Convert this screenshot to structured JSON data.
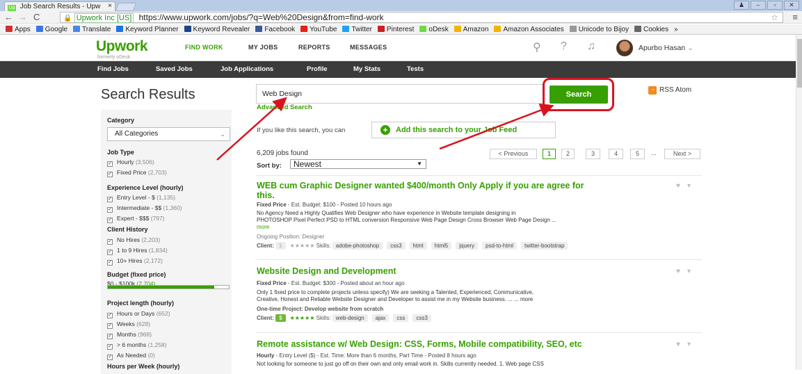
{
  "browser": {
    "tab_title": "Job Search Results - Upw",
    "tab_close": "×",
    "favicon": "Up",
    "url_org": "Upwork Inc [US]",
    "url": "https://www.upwork.com/jobs/?q=Web%20Design&from=find-work",
    "bookmarks": [
      {
        "label": "Apps",
        "icon_color": "#cc3333"
      },
      {
        "label": "Google",
        "icon_color": "#3b78e7"
      },
      {
        "label": "Translate",
        "icon_color": "#4a86e8"
      },
      {
        "label": "Keyword Planner",
        "icon_color": "#1a73e8"
      },
      {
        "label": "Keyword Revealer",
        "icon_color": "#1c4587"
      },
      {
        "label": "Facebook",
        "icon_color": "#3b5998"
      },
      {
        "label": "YouTube",
        "icon_color": "#e62117"
      },
      {
        "label": "Twitter",
        "icon_color": "#1da1f2"
      },
      {
        "label": "Pinterest",
        "icon_color": "#cb2027"
      },
      {
        "label": "oDesk",
        "icon_color": "#6fda44"
      },
      {
        "label": "Amazon",
        "icon_color": "#f3b400"
      },
      {
        "label": "Amazon Associates",
        "icon_color": "#f3b400"
      },
      {
        "label": "Unicode to Bijoy",
        "icon_color": "#999999"
      },
      {
        "label": "Cookies",
        "icon_color": "#666666"
      }
    ],
    "more": "»"
  },
  "header": {
    "logo": "Upwork",
    "logo_sub": "formerly oDesk",
    "nav": [
      "FIND WORK",
      "MY JOBS",
      "REPORTS",
      "MESSAGES"
    ],
    "username": "Apurbo Hasan"
  },
  "subnav": [
    "Find Jobs",
    "Saved Jobs",
    "Job Applications",
    "Profile",
    "My Stats",
    "Tests"
  ],
  "main": {
    "title": "Search Results",
    "search_value": "Web Design",
    "search_button": "Search",
    "advanced": "Advanced Search",
    "rss": "RSS Atom",
    "feed_text": "If you like this search, you can",
    "feed_button": "Add this search to your Job Feed",
    "jobs_found": "6,209 jobs found",
    "sort_label": "Sort by:",
    "sort_value": "Newest",
    "pager": {
      "prev": "< Previous",
      "pages": [
        "1",
        "2",
        "3",
        "4",
        "5"
      ],
      "ellipsis": "...",
      "next": "Next >"
    }
  },
  "sidebar": {
    "category_head": "Category",
    "category_value": "All Categories",
    "job_type_head": "Job Type",
    "job_type": [
      {
        "label": "Hourly",
        "count": "(3,506)"
      },
      {
        "label": "Fixed Price",
        "count": "(2,703)"
      }
    ],
    "exp_head": "Experience Level (hourly)",
    "exp": [
      {
        "label": "Entry Level - $",
        "count": "(1,135)"
      },
      {
        "label": "Intermediate - $$",
        "count": "(1,360)"
      },
      {
        "label": "Expert - $$$",
        "count": "(797)"
      }
    ],
    "client_head": "Client History",
    "client": [
      {
        "label": "No Hires",
        "count": "(2,203)"
      },
      {
        "label": "1 to 9 Hires",
        "count": "(1,834)"
      },
      {
        "label": "10+ Hires",
        "count": "(2,172)"
      }
    ],
    "budget_head": "Budget (fixed price)",
    "budget_range": "$0 - $100k",
    "budget_count": "(2,704)",
    "budget_fill": 0.88,
    "length_head": "Project length (hourly)",
    "length": [
      {
        "label": "Hours or Days",
        "count": "(652)"
      },
      {
        "label": "Weeks",
        "count": "(628)"
      },
      {
        "label": "Months",
        "count": "(968)"
      },
      {
        "label": "> 6 months",
        "count": "(1,258)"
      },
      {
        "label": "As Needed",
        "count": "(0)"
      }
    ],
    "hours_head": "Hours per Week (hourly)"
  },
  "jobs": [
    {
      "title": "WEB cum Graphic Designer wanted $400/month Only Apply if you are agree for",
      "title2": "this.",
      "type": "Fixed Price",
      "meta": " - Est. Budget: $100 - Posted 10 hours ago",
      "desc1": "No Agency Need a Highly Qualifies Web Designer who have experience in Website template designing in",
      "desc2": "PHOTOSHOP Pixel Perfect PSD to HTML conversion Responsive Web Page Design Cross Browser Web Page Design ...",
      "more": "more",
      "extra": "Ongoing Position: Designer",
      "client_label": "Client:",
      "client_badge": "$",
      "stars": "★★★★★",
      "skills_label": "Skills:",
      "skills": [
        "adobe-photoshop",
        "css3",
        "html",
        "html5",
        "jquery",
        "psd-to-html",
        "twitter-bootstrap"
      ]
    },
    {
      "title": "Website Design and Development",
      "type": "Fixed Price",
      "meta": " - Est. Budget: $300 - Posted about an hour ago",
      "desc1": "Only 1 fixed price to complete projects unless specify) We are seeking a Talented, Experienced, Communicative,",
      "desc2": "Creative, Honest and Reliable Website Designer and Developer to assist me in my Website business. ... ... more",
      "extra": "One-time Project: Develop website from scratch",
      "client_label": "Client:",
      "client_badge": "$",
      "stars": "★★★★★",
      "skills_label": "Skills:",
      "skills": [
        "web-design",
        "ajax",
        "css",
        "css3"
      ]
    },
    {
      "title": "Remote assistance w/ Web Design: CSS, Forms, Mobile compatibility, SEO, etc",
      "type": "Hourly",
      "meta": " - Entry Level ($) - Est. Time: More than 6 months, Part Time - Posted 8 hours ago",
      "desc1": "Not looking for someone to just go off on their own and only email work in. Skills currently needed. 1. Web page CSS"
    }
  ]
}
